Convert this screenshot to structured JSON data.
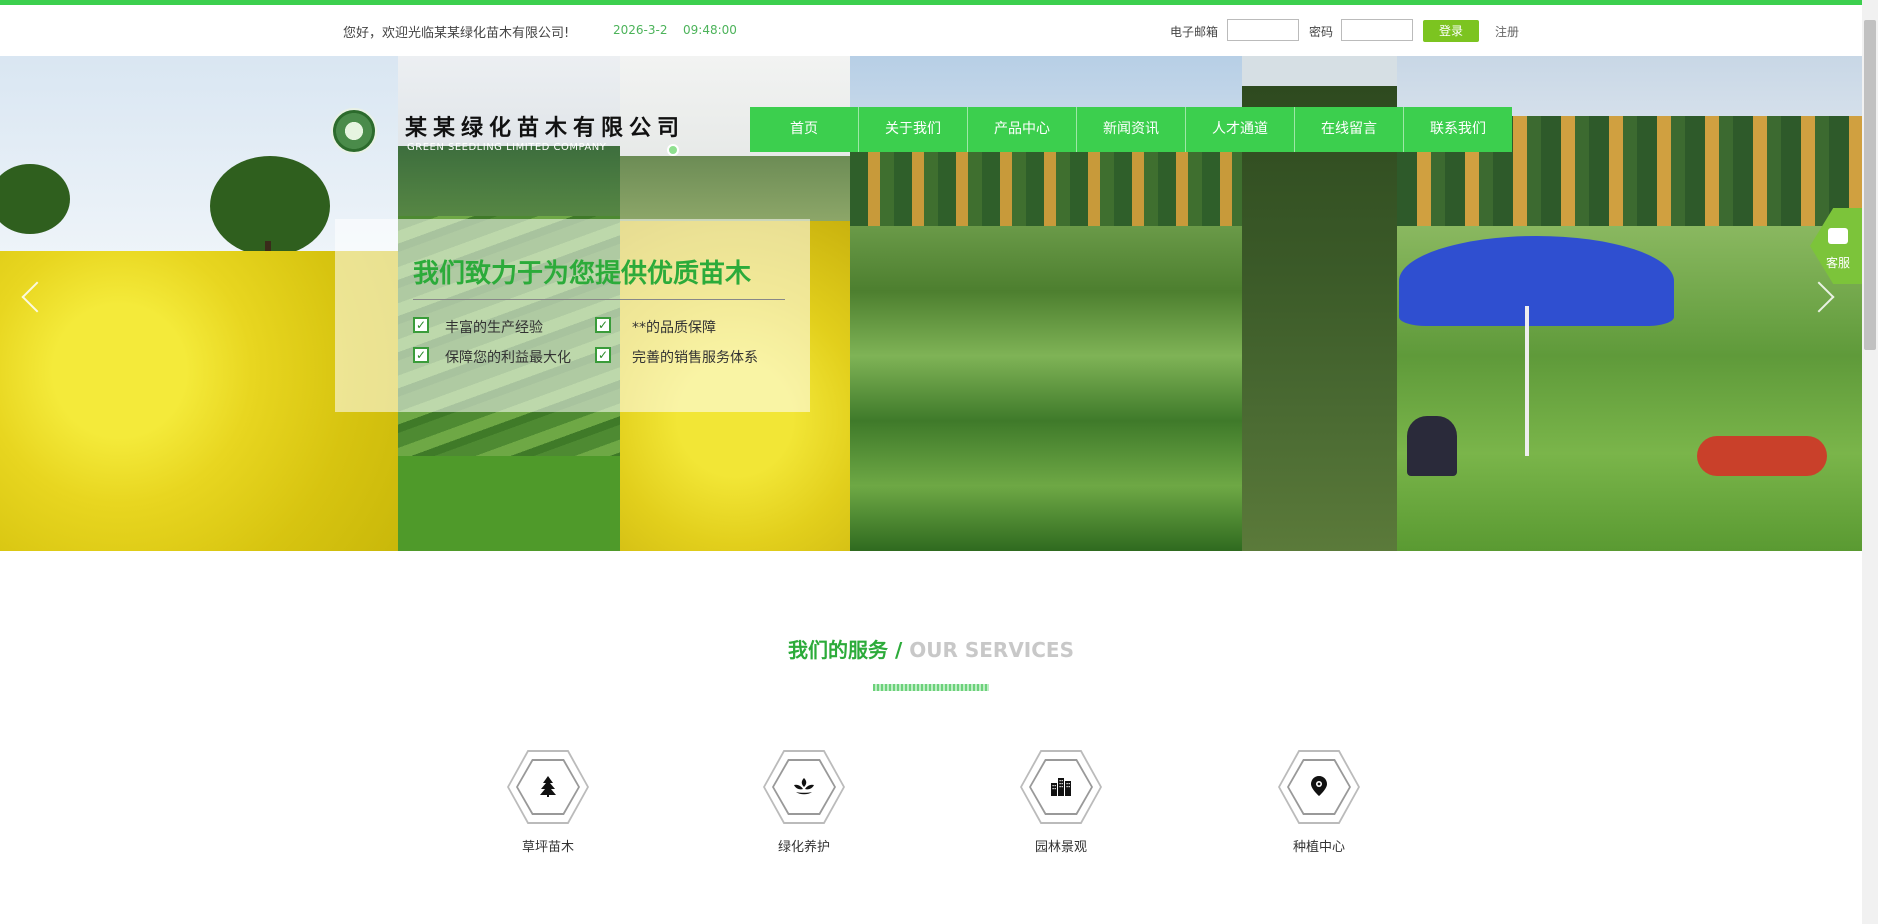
{
  "topbar": {
    "welcome": "您好，欢迎光临某某绿化苗木有限公司!",
    "date": "2026-3-2",
    "time": "09:48:00",
    "email_label": "电子邮箱",
    "password_label": "密码",
    "login_label": "登录",
    "register_label": "注册"
  },
  "logo": {
    "name_cn": "某某绿化苗木有限公司",
    "name_en": "GREEN SEEDLING LIMITED COMPANY"
  },
  "nav": {
    "items": [
      "首页",
      "关于我们",
      "产品中心",
      "新闻资讯",
      "人才通道",
      "在线留言",
      "联系我们"
    ]
  },
  "promo": {
    "title": "我们致力于为您提供优质苗木",
    "features": [
      "丰富的生产经验",
      "**的品质保障",
      "保障您的利益最大化",
      "完善的销售服务体系"
    ]
  },
  "sidebar": {
    "service_label": "客服"
  },
  "services": {
    "title_cn": "我们的服务",
    "separator": "/",
    "title_en": "OUR SERVICES",
    "items": [
      {
        "label": "草坪苗木",
        "icon": "tree-icon"
      },
      {
        "label": "绿化养护",
        "icon": "sprout-icon"
      },
      {
        "label": "园林景观",
        "icon": "buildings-icon"
      },
      {
        "label": "种植中心",
        "icon": "location-pin-icon"
      }
    ]
  },
  "colors": {
    "brand_green": "#3ccf4e",
    "login_green": "#7cc420",
    "title_green": "#2cab3a"
  }
}
